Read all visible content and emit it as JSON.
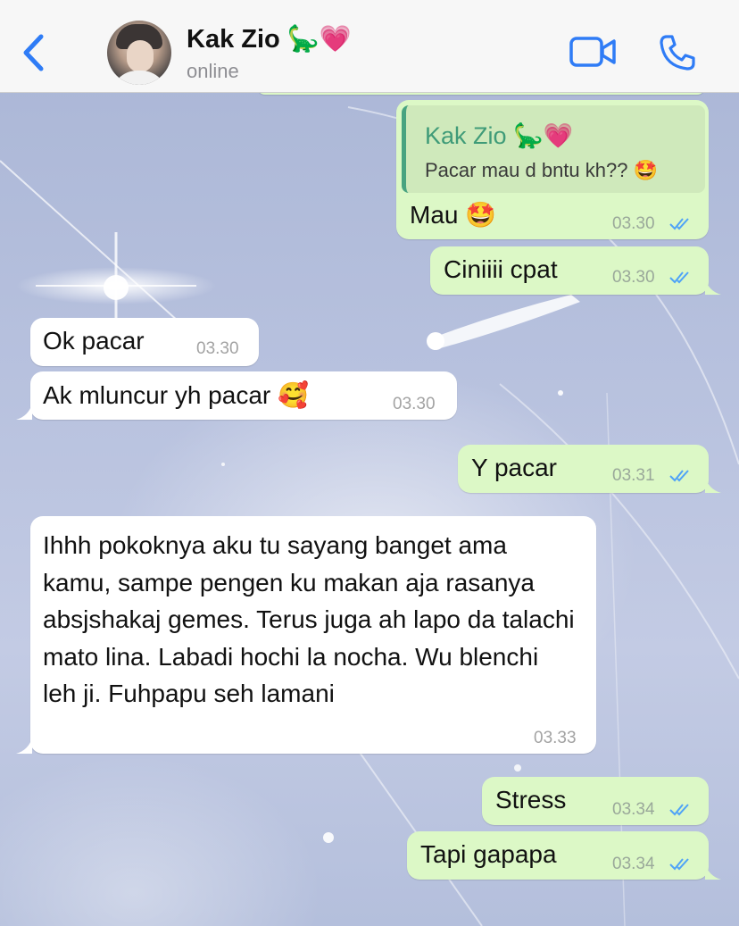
{
  "header": {
    "back_icon": "chevron-left-icon",
    "contact_name": "Kak Zio 🦕💗",
    "status": "online",
    "video_icon": "video-call-icon",
    "phone_icon": "phone-call-icon",
    "accent_color": "#2f7cf6"
  },
  "messages": [
    {
      "direction": "outgoing",
      "reply_to_name": "Kak Zio 🦕💗",
      "reply_to_text": "Pacar mau d bntu kh?? 🤩",
      "text": "Mau 🤩",
      "time": "03.30",
      "read": true
    },
    {
      "direction": "outgoing",
      "text": "Ciniiii cpat",
      "time": "03.30",
      "read": true
    },
    {
      "direction": "incoming",
      "text": "Ok pacar",
      "time": "03.30"
    },
    {
      "direction": "incoming",
      "text": "Ak mluncur yh pacar 🥰",
      "time": "03.30"
    },
    {
      "direction": "outgoing",
      "text": "Y pacar",
      "time": "03.31",
      "read": true
    },
    {
      "direction": "incoming",
      "text": "Ihhh pokoknya aku tu sayang banget ama kamu, sampe pengen ku makan aja rasanya absjshakaj gemes. Terus juga ah lapo da talachi mato lina. Labadi hochi la nocha. Wu blenchi leh ji. Fuhpapu seh lamani",
      "time": "03.33"
    },
    {
      "direction": "outgoing",
      "text": "Stress",
      "time": "03.34",
      "read": true
    },
    {
      "direction": "outgoing",
      "text": "Tapi gapapa",
      "time": "03.34",
      "read": true
    }
  ],
  "colors": {
    "outgoing_bubble": "#dcf8c6",
    "incoming_bubble": "#ffffff",
    "read_ticks": "#4fa3f7"
  }
}
